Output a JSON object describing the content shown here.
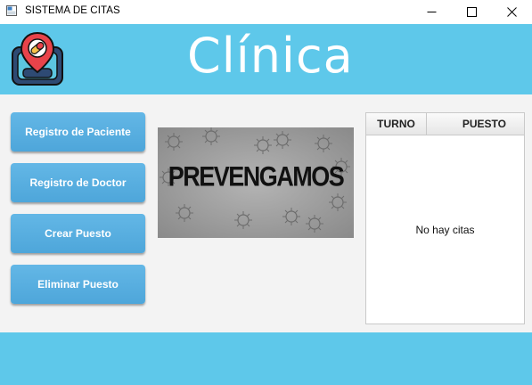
{
  "window": {
    "title": "SISTEMA DE CITAS"
  },
  "header": {
    "brand": "Clínica",
    "logo_icon": "map-pin-pill-icon"
  },
  "sidebar": {
    "buttons": [
      {
        "label": "Registro de Paciente"
      },
      {
        "label": "Registro de Doctor"
      },
      {
        "label": "Crear Puesto"
      },
      {
        "label": "Eliminar Puesto"
      }
    ]
  },
  "banner": {
    "text": "PREVENGAMOS"
  },
  "table": {
    "columns": [
      "TURNO",
      "PUESTO"
    ],
    "empty_text": "No hay citas"
  },
  "colors": {
    "header": "#5ec8ea",
    "button": "#55aadd",
    "background": "#f3f3f3"
  }
}
